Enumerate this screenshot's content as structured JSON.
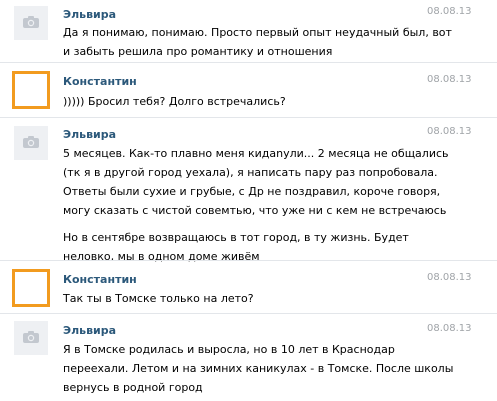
{
  "messages": [
    {
      "author": "Эльвира",
      "date": "08.08.13",
      "avatar": "camera-icon",
      "lines": [
        "Да я понимаю, понимаю. Просто первый опыт неудачный был, вот",
        "и забыть решила про романтику и отношения"
      ]
    },
    {
      "author": "Константин",
      "date": "08.08.13",
      "avatar": "empty-frame",
      "lines": [
        ")))))  Бросил тебя? Долго встречались?"
      ]
    },
    {
      "author": "Эльвира",
      "date": "08.08.13",
      "avatar": "camera-icon",
      "paragraphs": [
        [
          "5 месяцев. Как-то плавно меня кидanули... 2 месяца не общались",
          "(тк я в другой город уехала), я написать пару раз попробовала.",
          "Ответы были сухие и грубые, с Др не поздравил, короче говоря,",
          "могу сказать с чистой совемтью, что уже ни с кем не встречаюсь"
        ],
        [
          "Но в сентябре возвращаюсь в тот город, в ту жизнь. Будет",
          "неловко, мы в одном доме живём"
        ]
      ]
    },
    {
      "author": "Константин",
      "date": "08.08.13",
      "avatar": "empty-frame",
      "lines": [
        "Так ты в Томске только на лето?"
      ]
    },
    {
      "author": "Эльвира",
      "date": "08.08.13",
      "avatar": "camera-icon",
      "lines": [
        "Я в Томске родилась и выросла, но в 10 лет в Краснодар",
        "переехали. Летом и на зимних каникулах - в Томске. После школы",
        "вернусь в родной город"
      ]
    }
  ],
  "colors": {
    "author": "#2b587a",
    "date": "#a0a4a8",
    "frame": "#f29b1f",
    "separator": "#e3e6ea"
  }
}
